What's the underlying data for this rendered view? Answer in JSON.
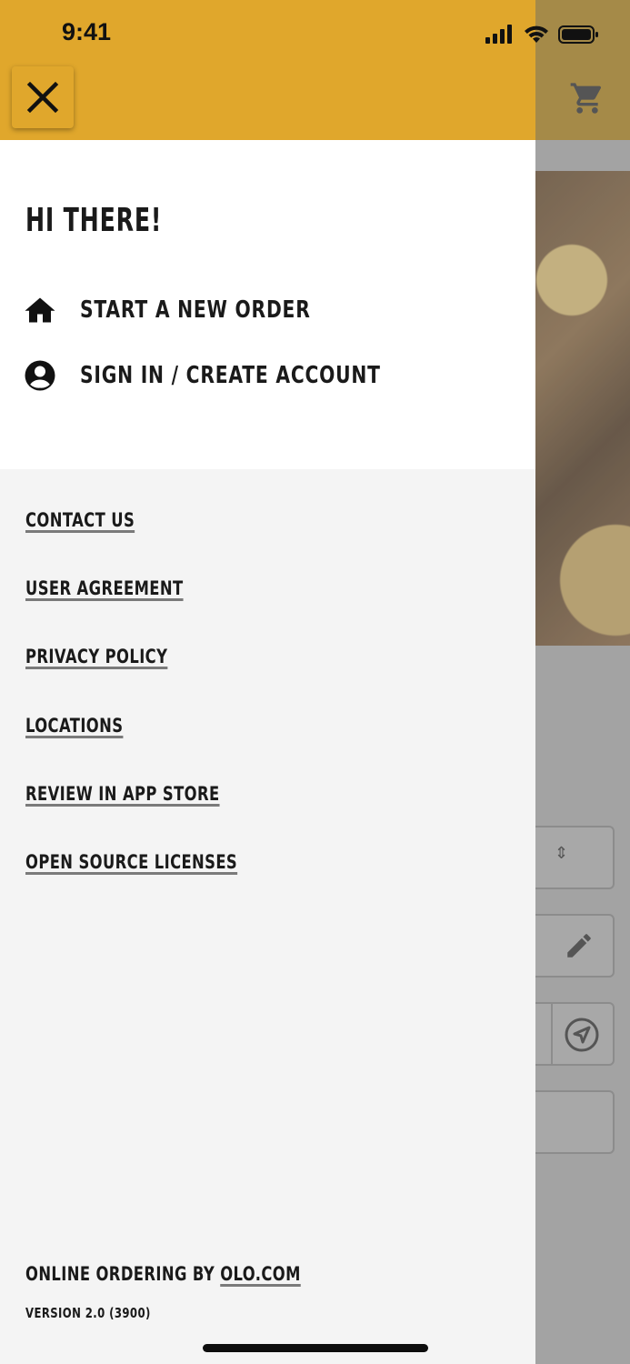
{
  "status_bar": {
    "time": "9:41"
  },
  "header": {
    "close_icon": "close-icon",
    "cart_icon": "cart-icon"
  },
  "drawer": {
    "greeting": "HI THERE!",
    "primary_items": [
      {
        "label": "START A NEW ORDER",
        "icon": "home-icon"
      },
      {
        "label": "SIGN IN / CREATE ACCOUNT",
        "icon": "account-circle-icon"
      }
    ],
    "links": [
      "CONTACT US",
      "USER AGREEMENT",
      "PRIVACY POLICY",
      "LOCATIONS",
      "REVIEW IN APP STORE",
      "OPEN SOURCE LICENSES"
    ],
    "footer": {
      "prefix": "ONLINE ORDERING BY ",
      "link": "OLO.COM",
      "version": "VERSION 2.0 (3900)"
    }
  },
  "colors": {
    "brand_yellow": "#e0a72c",
    "panel_white": "#ffffff",
    "panel_grey": "#f4f4f4",
    "text": "#1a1a1a"
  }
}
